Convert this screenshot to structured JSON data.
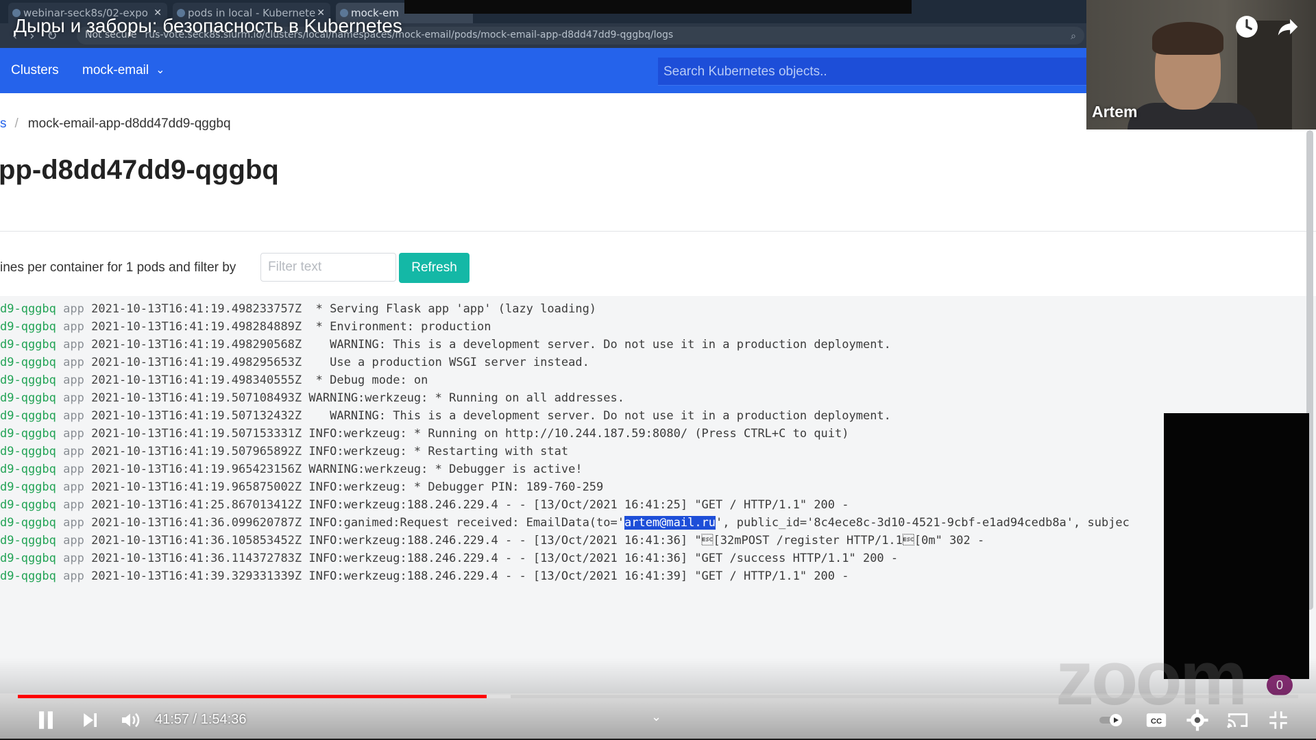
{
  "video": {
    "title": "Дыры и заборы: безопасность в Kubernetes",
    "current_time": "41:57",
    "duration": "1:54:36",
    "time_display": "41:57 / 1:54:36",
    "progress_fraction": 0.366,
    "buffered_fraction": 0.385,
    "speaker_name": "Artem",
    "notification_count": "0"
  },
  "browser": {
    "tabs": [
      {
        "label": "webinar-seck8s/02-expo"
      },
      {
        "label": "pods in local - Kubernete"
      },
      {
        "label": "mock-em"
      }
    ],
    "security_label": "Not secure",
    "url": "rus-vote.seck8s.slurm.io/clusters/local/namespaces/mock-email/pods/mock-email-app-d8dd47dd9-qggbq/logs"
  },
  "navbar": {
    "clusters_label": "Clusters",
    "context_label": "mock-email",
    "search_placeholder": "Search Kubernetes objects.."
  },
  "breadcrumb": {
    "parent": "s",
    "separator": "/",
    "current": "mock-email-app-d8dd47dd9-qggbq"
  },
  "page": {
    "title": "pp-d8dd47dd9-qggbq"
  },
  "filter": {
    "label": "ines per container for 1 pods and filter by",
    "placeholder": "Filter text",
    "refresh_label": "Refresh"
  },
  "logs": [
    {
      "pod": "d9-qggbq",
      "container": "app",
      "ts": "2021-10-13T16:41:19.498233757Z",
      "msg": " * Serving Flask app 'app' (lazy loading)"
    },
    {
      "pod": "d9-qggbq",
      "container": "app",
      "ts": "2021-10-13T16:41:19.498284889Z",
      "msg": " * Environment: production"
    },
    {
      "pod": "d9-qggbq",
      "container": "app",
      "ts": "2021-10-13T16:41:19.498290568Z",
      "msg": "   WARNING: This is a development server. Do not use it in a production deployment."
    },
    {
      "pod": "d9-qggbq",
      "container": "app",
      "ts": "2021-10-13T16:41:19.498295653Z",
      "msg": "   Use a production WSGI server instead."
    },
    {
      "pod": "d9-qggbq",
      "container": "app",
      "ts": "2021-10-13T16:41:19.498340555Z",
      "msg": " * Debug mode: on"
    },
    {
      "pod": "d9-qggbq",
      "container": "app",
      "ts": "2021-10-13T16:41:19.507108493Z",
      "msg": "WARNING:werkzeug: * Running on all addresses."
    },
    {
      "pod": "d9-qggbq",
      "container": "app",
      "ts": "2021-10-13T16:41:19.507132432Z",
      "msg": "   WARNING: This is a development server. Do not use it in a production deployment."
    },
    {
      "pod": "d9-qggbq",
      "container": "app",
      "ts": "2021-10-13T16:41:19.507153331Z",
      "msg": "INFO:werkzeug: * Running on http://10.244.187.59:8080/ (Press CTRL+C to quit)"
    },
    {
      "pod": "d9-qggbq",
      "container": "app",
      "ts": "2021-10-13T16:41:19.507965892Z",
      "msg": "INFO:werkzeug: * Restarting with stat"
    },
    {
      "pod": "d9-qggbq",
      "container": "app",
      "ts": "2021-10-13T16:41:19.965423156Z",
      "msg": "WARNING:werkzeug: * Debugger is active!"
    },
    {
      "pod": "d9-qggbq",
      "container": "app",
      "ts": "2021-10-13T16:41:19.965875002Z",
      "msg": "INFO:werkzeug: * Debugger PIN: 189-760-259"
    },
    {
      "pod": "d9-qggbq",
      "container": "app",
      "ts": "2021-10-13T16:41:25.867013412Z",
      "msg": "INFO:werkzeug:188.246.229.4 - - [13/Oct/2021 16:41:25] \"GET / HTTP/1.1\" 200 -"
    },
    {
      "pod": "d9-qggbq",
      "container": "app",
      "ts": "2021-10-13T16:41:36.099620787Z",
      "msg_before": "INFO:ganimed:Request received: EmailData(to='",
      "msg_selected": "artem@mail.ru",
      "msg_after": "', public_id='8c4ece8c-3d10-4521-9cbf-e1ad94cedb8a', subjec"
    },
    {
      "pod": "d9-qggbq",
      "container": "app",
      "ts": "2021-10-13T16:41:36.105853452Z",
      "msg": "INFO:werkzeug:188.246.229.4 - - [13/Oct/2021 16:41:36] \"\u001b[32mPOST /register HTTP/1.1\u001b[0m\" 302 -"
    },
    {
      "pod": "d9-qggbq",
      "container": "app",
      "ts": "2021-10-13T16:41:36.114372783Z",
      "msg": "INFO:werkzeug:188.246.229.4 - - [13/Oct/2021 16:41:36] \"GET /success HTTP/1.1\" 200 -"
    },
    {
      "pod": "d9-qggbq",
      "container": "app",
      "ts": "2021-10-13T16:41:39.329331339Z",
      "msg": "INFO:werkzeug:188.246.229.4 - - [13/Oct/2021 16:41:39] \"GET / HTTP/1.1\" 200 -"
    }
  ],
  "overlays": {
    "watermark": "zoom"
  },
  "icons": {
    "clock": "watch-later-icon",
    "share": "share-icon",
    "pause": "pause-icon",
    "next": "next-icon",
    "volume": "volume-icon",
    "autoplay": "autoplay-toggle-icon",
    "captions": "captions-icon",
    "settings": "gear-icon",
    "cast": "cast-icon",
    "fullscreen": "exit-fullscreen-icon"
  },
  "colors": {
    "navbar": "#2563eb",
    "refresh": "#14b8a6",
    "pod_name": "#22a355",
    "progress": "#ff0000",
    "selection": "#1d4ed8"
  }
}
